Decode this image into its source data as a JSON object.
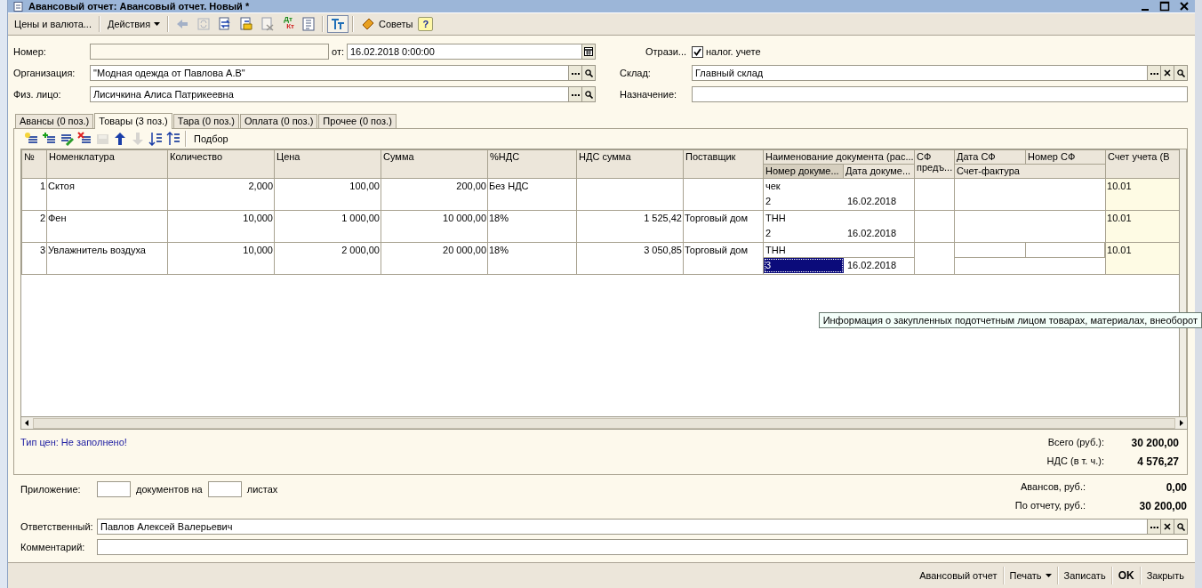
{
  "window": {
    "title": "Авансовый отчет: Авансовый отчет. Новый *"
  },
  "toolbar": {
    "items": [
      {
        "kind": "text",
        "label": "Цены и валюта..."
      },
      {
        "kind": "dropdown",
        "label": "Действия"
      },
      {
        "kind": "back",
        "disabled": true,
        "pressed": false
      },
      {
        "kind": "refresh",
        "disabled": true,
        "pressed": false
      },
      {
        "kind": "swap",
        "disabled": false,
        "pressed": false
      },
      {
        "kind": "post",
        "disabled": false,
        "pressed": false
      },
      {
        "kind": "unpost",
        "disabled": true,
        "pressed": false
      },
      {
        "kind": "dtkt",
        "top": "Дт",
        "bottom": "Кт",
        "disabled": false,
        "pressed": false
      },
      {
        "kind": "journal",
        "disabled": false,
        "pressed": false
      },
      {
        "kind": "structure",
        "disabled": false,
        "pressed": true
      },
      {
        "kind": "tips",
        "label": "Советы"
      },
      {
        "kind": "help",
        "label": "?"
      }
    ]
  },
  "header": {
    "number": {
      "label": "Номер:"
    },
    "date": {
      "label": "от:",
      "value": "16.02.2018  0:00:00"
    },
    "organization": {
      "label": "Организация:",
      "value": "\"Модная одежда от Павлова А.В\""
    },
    "person": {
      "label": "Физ. лицо:",
      "value": "Лисичкина Алиса Патрикеевна"
    },
    "tax": {
      "label": "Отрази...",
      "checkbox_label": "налог. учете",
      "checked": true
    },
    "warehouse": {
      "label": "Склад:",
      "value": "Главный склад"
    },
    "purpose": {
      "label": "Назначение:"
    }
  },
  "tabs": [
    {
      "label": "Авансы (0 поз.)",
      "selected": false
    },
    {
      "label": "Товары (3 поз.)",
      "selected": true
    },
    {
      "label": "Тара (0 поз.)",
      "selected": false
    },
    {
      "label": "Оплата (0 поз.)",
      "selected": false
    },
    {
      "label": "Прочее (0 поз.)",
      "selected": false
    }
  ],
  "table_toolbar": {
    "items": [
      {
        "kind": "add",
        "disabled": false
      },
      {
        "kind": "copy",
        "disabled": false
      },
      {
        "kind": "edit",
        "disabled": false
      },
      {
        "kind": "delete",
        "disabled": false
      },
      {
        "kind": "save",
        "disabled": true
      },
      {
        "kind": "up",
        "disabled": false
      },
      {
        "kind": "down",
        "disabled": true
      },
      {
        "kind": "sort-asc",
        "disabled": false
      },
      {
        "kind": "sort-desc",
        "disabled": false
      },
      {
        "kind": "text",
        "label": "Подбор"
      }
    ]
  },
  "table": {
    "columns": [
      "№",
      "Номенклатура",
      "Количество",
      "Цена",
      "Сумма",
      "%НДС",
      "НДС сумма",
      "Поставщик",
      "Наименование документа (рас...",
      "СФ предъ...",
      "Дата СФ",
      "Номер СФ",
      "Счет учета (В"
    ],
    "subheaders": [
      {
        "label": "Номер докуме...",
        "selected": true
      },
      {
        "label": "Дата докуме...",
        "selected": false
      },
      {
        "label": "Счет-фактура",
        "selected": false
      }
    ],
    "rows": [
      {
        "number": "1",
        "name": "Сктоя",
        "quantity": "2,000",
        "price": "100,00",
        "sum": "200,00",
        "vat_rate": "Без НДС",
        "doc_name": "чек",
        "doc_number": "2",
        "doc_date": "16.02.2018",
        "account": "10.01",
        "editing": false
      },
      {
        "number": "2",
        "name": "Фен",
        "quantity": "10,000",
        "price": "1 000,00",
        "sum": "10 000,00",
        "vat_rate": "18%",
        "vat_sum": "1 525,42",
        "supplier": "Торговый дом",
        "doc_name": "ТНН",
        "doc_number": "2",
        "doc_date": "16.02.2018",
        "account": "10.01",
        "editing": false
      },
      {
        "number": "3",
        "name": "Увлажнитель воздуха",
        "quantity": "10,000",
        "price": "2 000,00",
        "sum": "20 000,00",
        "vat_rate": "18%",
        "vat_sum": "3 050,85",
        "supplier": "Торговый дом",
        "doc_name": "ТНН",
        "doc_number": "3",
        "doc_date": "16.02.2018",
        "account": "10.01",
        "editing": true
      }
    ]
  },
  "tooltip": {
    "text": "Информация о закупленных подотчетным лицом товарах, материалах, внеоборот"
  },
  "panel_footer": {
    "price_type": "Тип цен: Не заполнено!",
    "totals": [
      {
        "label": "Всего (руб.):",
        "value": "30 200,00"
      },
      {
        "label": "НДС (в т. ч.):",
        "value": "4 576,27"
      }
    ]
  },
  "attachments": {
    "label": "Приложение:",
    "middle": "документов на",
    "end": "листах"
  },
  "summary": [
    {
      "label": "Авансов, руб.:",
      "value": "0,00"
    },
    {
      "label": "По отчету, руб.:",
      "value": "30 200,00"
    }
  ],
  "responsible": {
    "label": "Ответственный:",
    "value": "Павлов Алексей Валерьевич"
  },
  "comment": {
    "label": "Комментарий:"
  },
  "bottom_buttons": [
    {
      "kind": "plain",
      "label": "Авансовый отчет"
    },
    {
      "kind": "dropdown",
      "label": "Печать"
    },
    {
      "kind": "plain",
      "label": "Записать"
    },
    {
      "kind": "default",
      "label": "OK"
    },
    {
      "kind": "plain",
      "label": "Закрыть"
    }
  ]
}
